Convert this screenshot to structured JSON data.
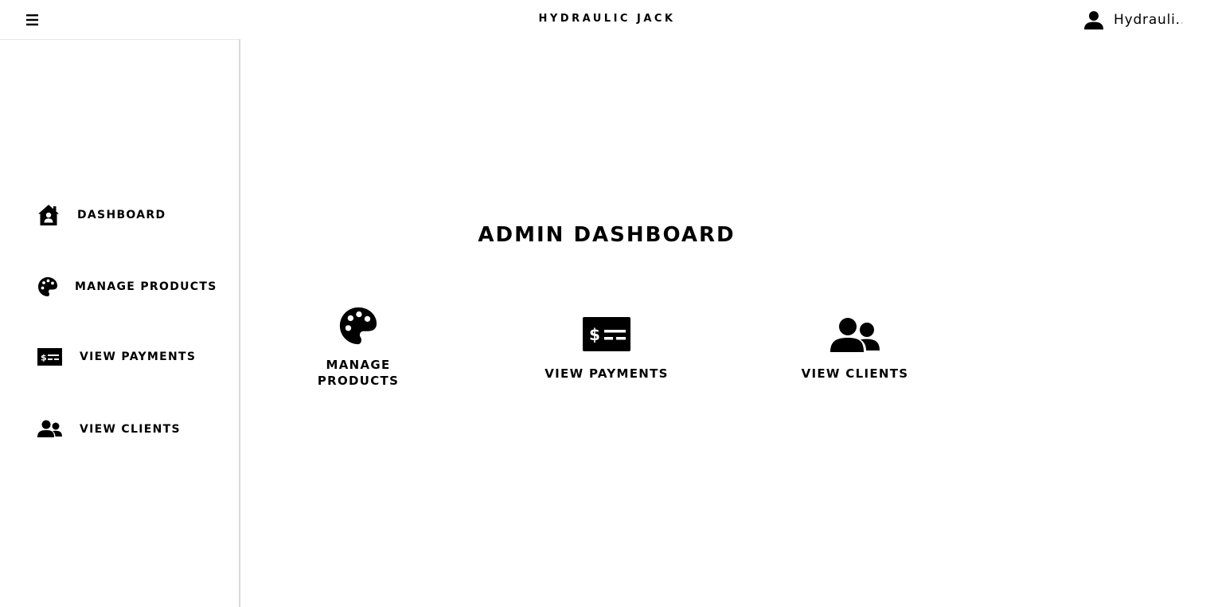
{
  "header": {
    "title": "HYDRAULIC JACK",
    "user_name": "Hydrauli...",
    "menu_icon": "hamburger-menu-icon",
    "user_icon": "user-icon"
  },
  "sidebar": {
    "items": [
      {
        "label": "DASHBOARD",
        "icon": "house-user-icon"
      },
      {
        "label": "MANAGE PRODUCTS",
        "icon": "palette-icon"
      },
      {
        "label": "VIEW PAYMENTS",
        "icon": "money-check-icon"
      },
      {
        "label": "VIEW CLIENTS",
        "icon": "user-friends-icon"
      }
    ]
  },
  "main": {
    "title": "ADMIN DASHBOARD",
    "cards": [
      {
        "label_line1": "MANAGE",
        "label_line2": "PRODUCTS",
        "icon": "palette-icon"
      },
      {
        "label": "VIEW PAYMENTS",
        "icon": "money-check-icon"
      },
      {
        "label": "VIEW CLIENTS",
        "icon": "user-friends-icon"
      }
    ]
  },
  "colors": {
    "background": "#ffffff",
    "text": "#000000",
    "divider": "#d9d9d9"
  }
}
